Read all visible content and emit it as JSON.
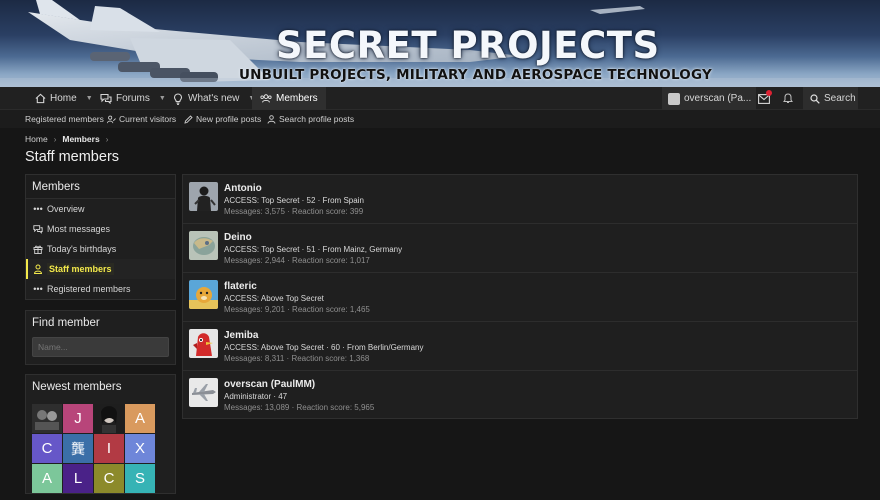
{
  "banner": {
    "title": "SECRET PROJECTS",
    "subtitle": "UNBUILT PROJECTS, MILITARY AND AEROSPACE TECHNOLOGY"
  },
  "nav": {
    "home": "Home",
    "forums": "Forums",
    "whats_new": "What's new",
    "members": "Members",
    "user": "overscan (Pa...",
    "search": "Search"
  },
  "subnav": {
    "registered": "Registered members",
    "visitors": "Current visitors",
    "profile_posts": "New profile posts",
    "search_posts": "Search profile posts"
  },
  "breadcrumb": {
    "home": "Home",
    "members": "Members"
  },
  "page_title": "Staff members",
  "sidebar": {
    "members_title": "Members",
    "items": [
      {
        "label": "Overview"
      },
      {
        "label": "Most messages"
      },
      {
        "label": "Today's birthdays"
      },
      {
        "label": "Staff members"
      },
      {
        "label": "Registered members"
      }
    ],
    "find_title": "Find member",
    "find_placeholder": "Name...",
    "newest_title": "Newest members",
    "newest": [
      {
        "letter": "",
        "color": "#3b3b3b"
      },
      {
        "letter": "J",
        "color": "#b8457a"
      },
      {
        "letter": "",
        "color": "#2a2a2a"
      },
      {
        "letter": "A",
        "color": "#d99a5e"
      },
      {
        "letter": "C",
        "color": "#6657c8"
      },
      {
        "letter": "龔",
        "color": "#3b6fa8"
      },
      {
        "letter": "I",
        "color": "#b23a44"
      },
      {
        "letter": "X",
        "color": "#6e86d9"
      },
      {
        "letter": "A",
        "color": "#7cc79a"
      },
      {
        "letter": "L",
        "color": "#4a2288"
      },
      {
        "letter": "C",
        "color": "#8c8a2b"
      },
      {
        "letter": "S",
        "color": "#36b3b5"
      }
    ]
  },
  "members": [
    {
      "name": "Antonio",
      "meta": "ACCESS: Top Secret · 52 · From Spain",
      "stats": "Messages: 3,575 · Reaction score: 399"
    },
    {
      "name": "Deino",
      "meta": "ACCESS: Top Secret · 51 · From Mainz, Germany",
      "stats": "Messages: 2,944 · Reaction score: 1,017"
    },
    {
      "name": "flateric",
      "meta": "ACCESS: Above Top Secret",
      "stats": "Messages: 9,201 · Reaction score: 1,465"
    },
    {
      "name": "Jemiba",
      "meta": "ACCESS: Above Top Secret · 60 · From Berlin/Germany",
      "stats": "Messages: 8,311 · Reaction score: 1,368"
    },
    {
      "name": "overscan (PaulMM)",
      "meta": "Administrator · 47",
      "stats": "Messages: 13,089 · Reaction score: 5,965"
    }
  ],
  "colors": {
    "accent": "#f2e84b",
    "background": "#161616",
    "panel": "#1f1f1f"
  }
}
